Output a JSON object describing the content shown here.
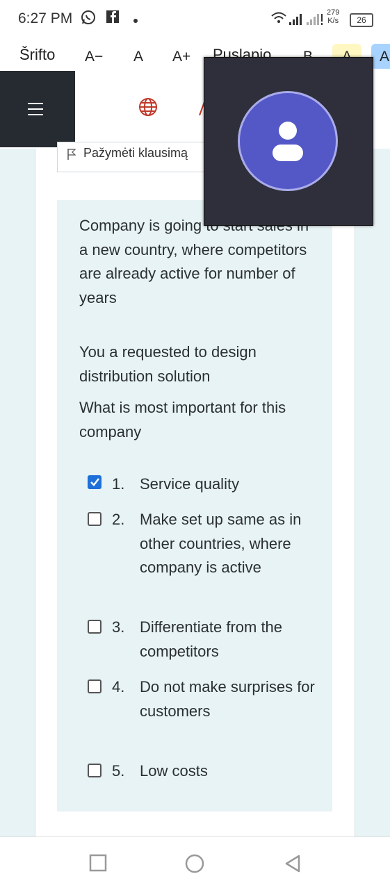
{
  "status_bar": {
    "time": "6:27 PM",
    "speed_value": "279",
    "speed_unit": "K/s",
    "battery": "26"
  },
  "toolbar": {
    "font_label": "Šrifto",
    "decrease": "A−",
    "normal": "A",
    "increase": "A+",
    "page_label": "Puslapio",
    "color_b": "B",
    "color_a1": "A",
    "color_a2": "A",
    "highlight_yellow": "#fff7c2",
    "highlight_blue": "#a9d3ff"
  },
  "question": {
    "flag_label": "Pažymėti klausimą",
    "paragraphs": [
      "Company is going to start sales in a new country, where competitors are already active for number of years",
      "You a requested to design distribution solution",
      "What is most important for this company"
    ],
    "options": [
      {
        "num": "1.",
        "text": "Service quality",
        "checked": true
      },
      {
        "num": "2.",
        "text": "Make set up same as in other countries, where company is active",
        "checked": false
      },
      {
        "num": "3.",
        "text": "Differentiate from the competitors",
        "checked": false
      },
      {
        "num": "4.",
        "text": "Do not make surprises for customers",
        "checked": false
      },
      {
        "num": "5.",
        "text": "Low costs",
        "checked": false
      }
    ]
  },
  "colors": {
    "accent": "#1e6fd9",
    "avatar": "#5457c6",
    "nav_dark": "#262b31",
    "question_bg": "#e7f3f5"
  }
}
